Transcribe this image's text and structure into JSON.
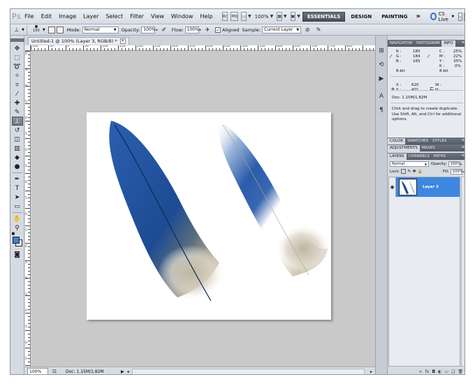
{
  "app": {
    "logo": "Ps"
  },
  "menu": [
    "File",
    "Edit",
    "Image",
    "Layer",
    "Select",
    "Filter",
    "View",
    "Window",
    "Help"
  ],
  "menubar": {
    "zoom": "100%",
    "br_label": "Br",
    "mb_label": "Mb"
  },
  "workspaces": [
    {
      "label": "ESSENTIALS",
      "active": true
    },
    {
      "label": "DESIGN",
      "active": false
    },
    {
      "label": "PAINTING",
      "active": false
    }
  ],
  "workspace_more": "»",
  "cslive": "CS Live",
  "options": {
    "brush_size": "150",
    "mode_label": "Mode:",
    "mode_value": "Normal",
    "opacity_label": "Opacity:",
    "opacity_value": "100%",
    "flow_label": "Flow:",
    "flow_value": "100%",
    "aligned_label": "Aligned",
    "sample_label": "Sample:",
    "sample_value": "Current Layer"
  },
  "document": {
    "tab_title": "Untitled-1 @ 100% (Layer 3, RGB/8) *",
    "ruler_h_labels": [
      "100",
      "50",
      "0",
      "50",
      "100",
      "150",
      "200",
      "250",
      "300",
      "350",
      "400",
      "450",
      "500",
      "550",
      "600",
      "650",
      "700",
      "750",
      "800"
    ],
    "ruler_v_labels": [
      "0",
      "5",
      "0",
      "5",
      "0",
      "5",
      "0",
      "5",
      "0",
      "5",
      "0",
      "5",
      "0",
      "5",
      "0",
      "5",
      "0",
      "5",
      "0",
      "5"
    ]
  },
  "status": {
    "zoom": "100%",
    "doc_info": "Doc: 1.15M/1.82M"
  },
  "info_panel": {
    "tabs": [
      "NAVIGATOR",
      "HISTOGRAM",
      "INFO"
    ],
    "active_tab": "INFO",
    "rgb": {
      "R_label": "R :",
      "R": "185",
      "G_label": "G :",
      "G": "184",
      "B_label": "B :",
      "B": "165"
    },
    "cmyk": {
      "C_label": "C :",
      "C": "25%",
      "M_label": "M :",
      "M": "22%",
      "Y_label": "Y :",
      "Y": "35%",
      "K_label": "K :",
      "K": "0%"
    },
    "bit_left": "8-bit",
    "bit_right": "8-bit",
    "xy": {
      "X_label": "X :",
      "X": "620",
      "Y_label": "Y :",
      "Y": "401"
    },
    "wh": {
      "W_label": "W :",
      "H_label": "H :"
    },
    "doc": "Doc: 1.15M/1.82M",
    "hint": "Click and drag to create duplicate. Use Shift, Alt, and Ctrl for additional options."
  },
  "color_panel": {
    "tabs": [
      "COLOR",
      "SWATCHES",
      "STYLES"
    ]
  },
  "adjust_panel": {
    "tabs": [
      "ADJUSTMENTS",
      "MASKS"
    ]
  },
  "layers_panel": {
    "tabs": [
      "LAYERS",
      "CHANNELS",
      "PATHS"
    ],
    "blend_mode": "Normal",
    "opacity_label": "Opacity:",
    "opacity": "100%",
    "lock_label": "Lock:",
    "fill_label": "Fill:",
    "fill": "100%",
    "layers": [
      {
        "name": "Layer 3",
        "selected": true
      }
    ]
  },
  "colors": {
    "foreground": "#3f7fd6",
    "background": "#ffffff",
    "accent": "#3d87e0",
    "feather_blue": "#1f4f9c"
  }
}
